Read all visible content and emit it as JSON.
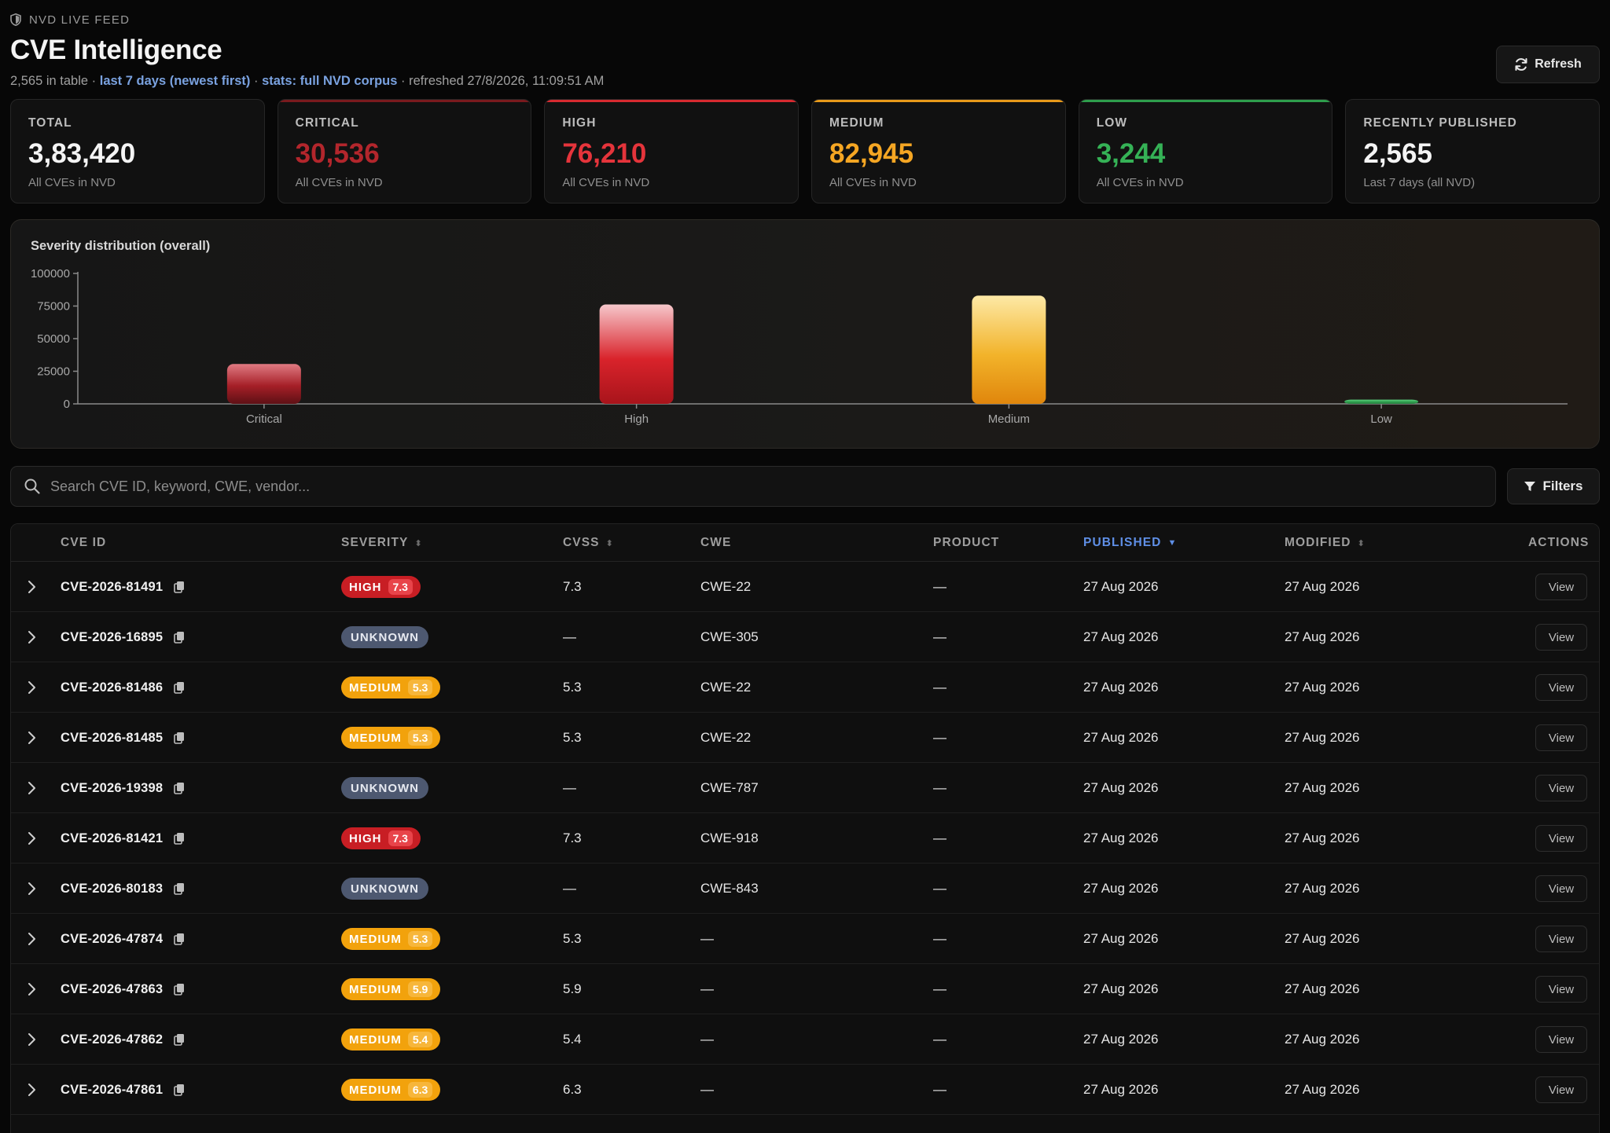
{
  "header": {
    "feed_tag": "NVD LIVE FEED",
    "title": "CVE Intelligence",
    "subtitle_prefix": "2,565 in table · ",
    "subtitle_range": "last 7 days (newest first)",
    "subtitle_sep": " · ",
    "subtitle_stats": "stats: full NVD corpus",
    "subtitle_refreshed": " · refreshed 27/8/2026, 11:09:51 AM",
    "refresh_label": "Refresh"
  },
  "stats": [
    {
      "label": "TOTAL",
      "value": "3,83,420",
      "sub": "All CVEs in NVD",
      "color": "#f4f4f4",
      "accent": ""
    },
    {
      "label": "CRITICAL",
      "value": "30,536",
      "sub": "All CVEs in NVD",
      "color": "#b3262c",
      "accent": "#7a1a1e"
    },
    {
      "label": "HIGH",
      "value": "76,210",
      "sub": "All CVEs in NVD",
      "color": "#e5343b",
      "accent": "#d72a30"
    },
    {
      "label": "MEDIUM",
      "value": "82,945",
      "sub": "All CVEs in NVD",
      "color": "#f5a623",
      "accent": "#e89a1a"
    },
    {
      "label": "LOW",
      "value": "3,244",
      "sub": "All CVEs in NVD",
      "color": "#35b256",
      "accent": "#2e9e4c"
    },
    {
      "label": "RECENTLY PUBLISHED",
      "value": "2,565",
      "sub": "Last 7 days (all NVD)",
      "color": "#f4f4f4",
      "accent": ""
    }
  ],
  "chart_data": {
    "type": "bar",
    "title": "Severity distribution (overall)",
    "categories": [
      "Critical",
      "High",
      "Medium",
      "Low"
    ],
    "values": [
      30536,
      76210,
      82945,
      3244
    ],
    "yticks": [
      "0",
      "25000",
      "50000",
      "75000",
      "100000"
    ],
    "ylim": [
      0,
      100000
    ],
    "colors": [
      "#a11d26",
      "#d9232b",
      "#f0a21a",
      "#2f9e4e"
    ],
    "grid": false
  },
  "search": {
    "placeholder": "Search CVE ID, keyword, CWE, vendor..."
  },
  "filters_label": "Filters",
  "table": {
    "columns": {
      "cve_id": "CVE ID",
      "severity": "SEVERITY",
      "cvss": "CVSS",
      "cwe": "CWE",
      "product": "PRODUCT",
      "published": "PUBLISHED",
      "modified": "MODIFIED",
      "actions": "ACTIONS"
    },
    "view_label": "View",
    "rows": [
      {
        "id": "CVE-2026-81491",
        "severity": "HIGH",
        "score": "7.3",
        "cvss": "7.3",
        "cwe": "CWE-22",
        "product": "—",
        "published": "27 Aug 2026",
        "modified": "27 Aug 2026"
      },
      {
        "id": "CVE-2026-16895",
        "severity": "UNKNOWN",
        "score": "",
        "cvss": "—",
        "cwe": "CWE-305",
        "product": "—",
        "published": "27 Aug 2026",
        "modified": "27 Aug 2026"
      },
      {
        "id": "CVE-2026-81486",
        "severity": "MEDIUM",
        "score": "5.3",
        "cvss": "5.3",
        "cwe": "CWE-22",
        "product": "—",
        "published": "27 Aug 2026",
        "modified": "27 Aug 2026"
      },
      {
        "id": "CVE-2026-81485",
        "severity": "MEDIUM",
        "score": "5.3",
        "cvss": "5.3",
        "cwe": "CWE-22",
        "product": "—",
        "published": "27 Aug 2026",
        "modified": "27 Aug 2026"
      },
      {
        "id": "CVE-2026-19398",
        "severity": "UNKNOWN",
        "score": "",
        "cvss": "—",
        "cwe": "CWE-787",
        "product": "—",
        "published": "27 Aug 2026",
        "modified": "27 Aug 2026"
      },
      {
        "id": "CVE-2026-81421",
        "severity": "HIGH",
        "score": "7.3",
        "cvss": "7.3",
        "cwe": "CWE-918",
        "product": "—",
        "published": "27 Aug 2026",
        "modified": "27 Aug 2026"
      },
      {
        "id": "CVE-2026-80183",
        "severity": "UNKNOWN",
        "score": "",
        "cvss": "—",
        "cwe": "CWE-843",
        "product": "—",
        "published": "27 Aug 2026",
        "modified": "27 Aug 2026"
      },
      {
        "id": "CVE-2026-47874",
        "severity": "MEDIUM",
        "score": "5.3",
        "cvss": "5.3",
        "cwe": "—",
        "product": "—",
        "published": "27 Aug 2026",
        "modified": "27 Aug 2026"
      },
      {
        "id": "CVE-2026-47863",
        "severity": "MEDIUM",
        "score": "5.9",
        "cvss": "5.9",
        "cwe": "—",
        "product": "—",
        "published": "27 Aug 2026",
        "modified": "27 Aug 2026"
      },
      {
        "id": "CVE-2026-47862",
        "severity": "MEDIUM",
        "score": "5.4",
        "cvss": "5.4",
        "cwe": "—",
        "product": "—",
        "published": "27 Aug 2026",
        "modified": "27 Aug 2026"
      },
      {
        "id": "CVE-2026-47861",
        "severity": "MEDIUM",
        "score": "6.3",
        "cvss": "6.3",
        "cwe": "—",
        "product": "—",
        "published": "27 Aug 2026",
        "modified": "27 Aug 2026"
      }
    ]
  }
}
